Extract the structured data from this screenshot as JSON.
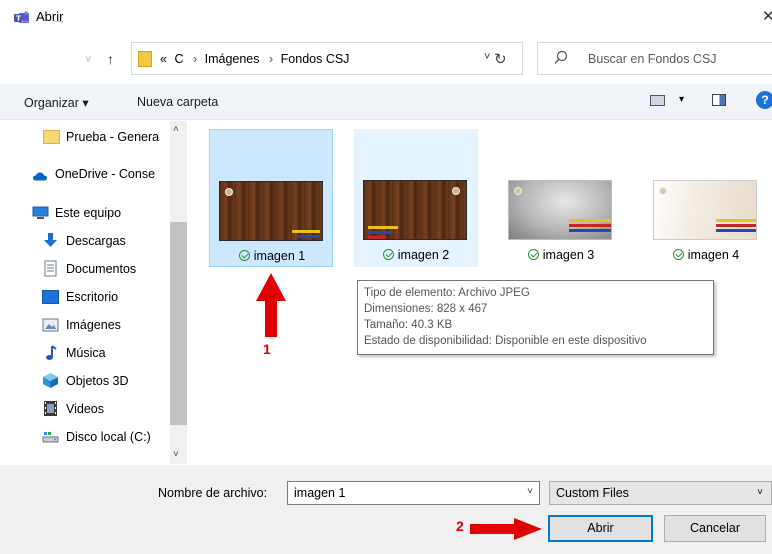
{
  "window": {
    "title": "Abrir",
    "close_glyph": "✕"
  },
  "nav": {
    "back": "←",
    "forward": "→",
    "recent": "˅",
    "up": "↑"
  },
  "address": {
    "crumbs": [
      "«",
      "C",
      "Imágenes",
      "Fondos CSJ"
    ],
    "separator": "›",
    "dropdown": "˅",
    "refresh": "↻"
  },
  "search": {
    "placeholder": "Buscar en Fondos CSJ"
  },
  "toolbar": {
    "organize": "Organizar ▾",
    "new_folder": "Nueva carpeta",
    "view_dropdown": "▾",
    "help": "?"
  },
  "sidebar": {
    "items": [
      {
        "label": "Prueba - Genera",
        "icon": "folder-icon"
      },
      {
        "label": "OneDrive - Conse",
        "icon": "cloud-icon"
      },
      {
        "label": "Este equipo",
        "icon": "computer-icon"
      },
      {
        "label": "Descargas",
        "icon": "download-icon"
      },
      {
        "label": "Documentos",
        "icon": "documents-icon"
      },
      {
        "label": "Escritorio",
        "icon": "desktop-icon"
      },
      {
        "label": "Imágenes",
        "icon": "pictures-icon"
      },
      {
        "label": "Música",
        "icon": "music-icon"
      },
      {
        "label": "Objetos 3D",
        "icon": "cube-icon"
      },
      {
        "label": "Videos",
        "icon": "video-icon"
      },
      {
        "label": "Disco local (C:)",
        "icon": "drive-icon"
      }
    ],
    "scroll_up": "˄",
    "scroll_down": "˅"
  },
  "files": [
    {
      "name": "imagen 1",
      "state": "selected"
    },
    {
      "name": "imagen 2",
      "state": "hover"
    },
    {
      "name": "imagen 3",
      "state": "normal"
    },
    {
      "name": "imagen 4",
      "state": "normal"
    }
  ],
  "tooltip": {
    "lines": [
      "Tipo de elemento: Archivo JPEG",
      "Dimensiones: 828 x 467",
      "Tamaño: 40.3 KB",
      "Estado de disponibilidad: Disponible en este dispositivo"
    ]
  },
  "annotations": {
    "step1": "1",
    "step2": "2",
    "color": "#e00000"
  },
  "footer": {
    "filename_label": "Nombre de archivo:",
    "filename_value": "imagen 1",
    "filter_value": "Custom Files",
    "dropdown": "˅",
    "open_button": "Abrir",
    "cancel_button": "Cancelar"
  },
  "colors": {
    "selection": "#cce8ff",
    "accent": "#0078d7",
    "check": "#2e8b3a"
  }
}
